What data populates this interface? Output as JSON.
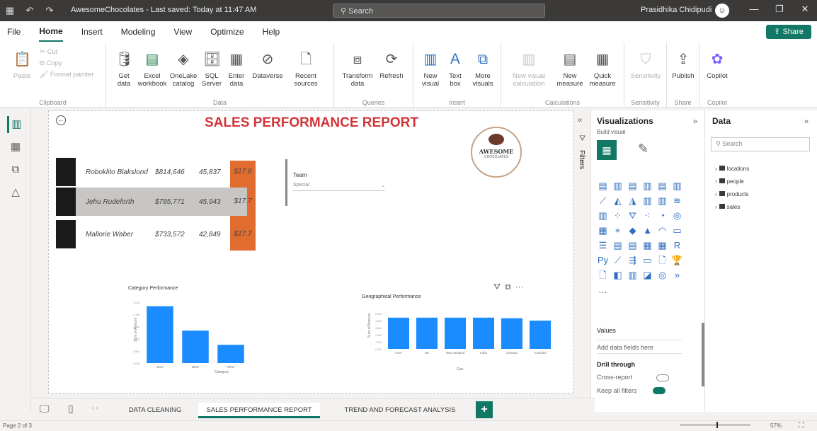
{
  "window": {
    "doc_title": "AwesomeChocolates - Last saved: Today at 11:47 AM",
    "search_placeholder": "Search",
    "user_name": "Prasidhika Chidipudi"
  },
  "menu": {
    "items": [
      "File",
      "Home",
      "Insert",
      "Modeling",
      "View",
      "Optimize",
      "Help"
    ],
    "share_label": "Share"
  },
  "ribbon": {
    "clipboard": {
      "label": "Clipboard",
      "paste": "Paste",
      "cut": "Cut",
      "copy": "Copy",
      "format_painter": "Format painter"
    },
    "data": {
      "label": "Data",
      "get_data": "Get data",
      "excel": "Excel workbook",
      "onelake": "OneLake catalog",
      "sql": "SQL Server",
      "enter_data": "Enter data",
      "dataverse": "Dataverse",
      "recent": "Recent sources"
    },
    "queries": {
      "label": "Queries",
      "transform": "Transform data",
      "refresh": "Refresh"
    },
    "insert": {
      "label": "Insert",
      "new_visual": "New visual",
      "text_box": "Text box",
      "more_visuals": "More visuals"
    },
    "calculations": {
      "label": "Calculations",
      "new_visual_calc": "New visual calculation",
      "new_measure": "New measure",
      "quick_measure": "Quick measure"
    },
    "sensitivity": {
      "label": "Sensitivity",
      "sensitivity_btn": "Sensitivity"
    },
    "share": {
      "label": "Share",
      "publish": "Publish"
    },
    "copilot": {
      "label": "Copilot",
      "copilot_btn": "Copilot"
    }
  },
  "report": {
    "title": "SALES PERFORMANCE REPORT",
    "logo_text": "AWESOME",
    "logo_sub": "CHOCOLATES",
    "people": [
      {
        "name": "Roboklito Blakslond",
        "revenue": "$814,646",
        "count": "45,837",
        "rating": "$17.8"
      },
      {
        "name": "Jehu Rudeforth",
        "revenue": "$785,771",
        "count": "45,943",
        "rating": "$17.7"
      },
      {
        "name": "Mallorie Waber",
        "revenue": "$733,572",
        "count": "42,849",
        "rating": "$17.7"
      }
    ],
    "slicer_title": "Team",
    "slicer_value": "Special"
  },
  "chart_data": [
    {
      "type": "bar",
      "title": "Category Performance",
      "xlabel": "Category",
      "ylabel": "Sum of Amount",
      "categories": [
        "Bars",
        "Bites",
        "Other"
      ],
      "values": [
        2.8,
        1.6,
        0.9
      ],
      "ylim": [
        0,
        3.0
      ],
      "colors": [
        "#1a8cff"
      ]
    },
    {
      "type": "bar",
      "title": "Geographical Performance",
      "xlabel": "Geo",
      "ylabel": "Sum of Amount",
      "categories": [
        "USA",
        "UK",
        "New Zealand",
        "India",
        "Canada",
        "Australia"
      ],
      "values": [
        5.3,
        5.3,
        5.3,
        5.3,
        5.2,
        4.8
      ],
      "ylim": [
        0,
        6.0
      ],
      "colors": [
        "#1a8cff"
      ]
    }
  ],
  "pages": {
    "tabs": [
      "DATA CLEANING",
      "SALES PERFORMANCE REPORT",
      "TREND AND FORECAST ANALYSIS"
    ],
    "page_info": "Page 2 of 3",
    "zoom": "57%"
  },
  "filters_label": "Filters",
  "visualizations": {
    "title": "Visualizations",
    "build_visual": "Build visual",
    "values_label": "Values",
    "values_placeholder": "Add data fields here",
    "drill_through": "Drill through",
    "cross_report": "Cross-report",
    "cross_report_state": "Off",
    "keep_all_filters": "Keep all filters",
    "keep_all_filters_state": "On"
  },
  "data_pane": {
    "title": "Data",
    "search_placeholder": "Search",
    "tables": [
      "locations",
      "people",
      "products",
      "sales"
    ]
  },
  "colors": {
    "accent": "#117865",
    "title_red": "#d13438",
    "bar_blue": "#1a8cff",
    "rating_orange": "#e06c2f"
  }
}
